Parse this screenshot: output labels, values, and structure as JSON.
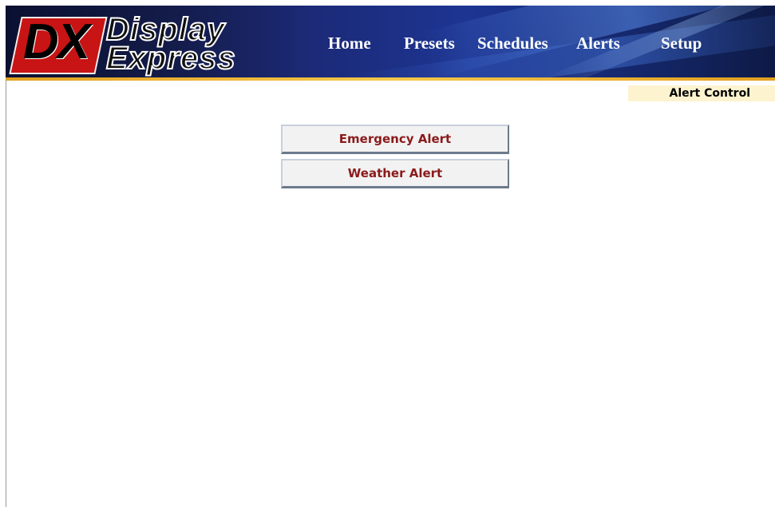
{
  "app": {
    "logo_mark": "DX",
    "logo_line1": "Display",
    "logo_line2": "Express"
  },
  "nav": {
    "home": "Home",
    "presets": "Presets",
    "schedules": "Schedules",
    "alerts": "Alerts",
    "setup": "Setup"
  },
  "page": {
    "section_label": "Alert Control"
  },
  "alerts": {
    "emergency_label": "Emergency Alert",
    "weather_label": "Weather Alert"
  },
  "colors": {
    "header_dark": "#0a1030",
    "header_blue": "#1d3592",
    "accent_gold": "#f5c84a",
    "logo_red": "#c81414",
    "button_text": "#8b1a1a",
    "section_label_bg": "#fdf3cf"
  }
}
